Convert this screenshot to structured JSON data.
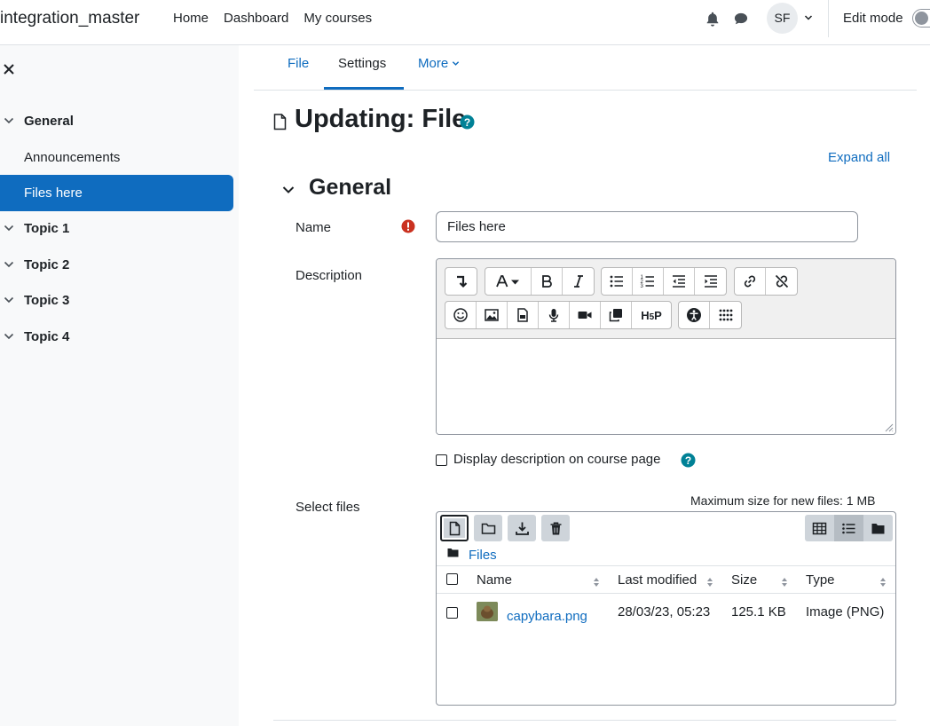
{
  "header": {
    "site_name": "integration_master",
    "nav": [
      "Home",
      "Dashboard",
      "My courses"
    ],
    "avatar_initials": "SF",
    "edit_mode_label": "Edit mode"
  },
  "drawer": {
    "items": [
      {
        "label": "General",
        "type": "section"
      },
      {
        "label": "Announcements",
        "type": "activity"
      },
      {
        "label": "Files here",
        "type": "activity",
        "active": true
      },
      {
        "label": "Topic 1",
        "type": "section"
      },
      {
        "label": "Topic 2",
        "type": "section"
      },
      {
        "label": "Topic 3",
        "type": "section"
      },
      {
        "label": "Topic 4",
        "type": "section"
      }
    ]
  },
  "tabs": [
    {
      "label": "File"
    },
    {
      "label": "Settings",
      "active": true
    },
    {
      "label": "More"
    }
  ],
  "page": {
    "title": "Updating: File",
    "expand_all": "Expand all",
    "section_title": "General"
  },
  "form": {
    "name_label": "Name",
    "name_value": "Files here",
    "description_label": "Description",
    "display_description_label": "Display description on course page",
    "select_files_label": "Select files",
    "max_size": "Maximum size for new files: 1 MB"
  },
  "filepicker": {
    "path": "Files",
    "columns": [
      "Name",
      "Last modified",
      "Size",
      "Type"
    ],
    "files": [
      {
        "name": "capybara.png",
        "modified": "28/03/23, 05:23",
        "size": "125.1 KB",
        "type": "Image (PNG)"
      }
    ]
  },
  "colors": {
    "primary": "#0f6cbf",
    "danger": "#ca3120",
    "help": "#008196",
    "drawer_bg": "#f8f9fa"
  }
}
